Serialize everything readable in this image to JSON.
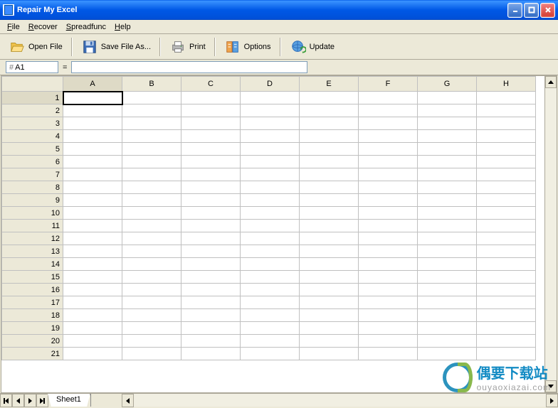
{
  "titlebar": {
    "title": "Repair My Excel"
  },
  "menu": {
    "file": "File",
    "recover": "Recover",
    "spreadfunc": "Spreadfunc",
    "help": "Help"
  },
  "toolbar": {
    "open": "Open File",
    "save": "Save File As...",
    "print": "Print",
    "options": "Options",
    "update": "Update"
  },
  "formula": {
    "cell_ref": "A1",
    "equals": "=",
    "value": ""
  },
  "columns": [
    "A",
    "B",
    "C",
    "D",
    "E",
    "F",
    "G",
    "H"
  ],
  "rows": [
    "1",
    "2",
    "3",
    "4",
    "5",
    "6",
    "7",
    "8",
    "9",
    "10",
    "11",
    "12",
    "13",
    "14",
    "15",
    "16",
    "17",
    "18",
    "19",
    "20",
    "21"
  ],
  "selected": {
    "col": "A",
    "row": "1"
  },
  "tabs": {
    "sheet1": "Sheet1"
  },
  "watermark": {
    "title": "偶要下载站",
    "url": "ouyaoxiazai.com"
  }
}
